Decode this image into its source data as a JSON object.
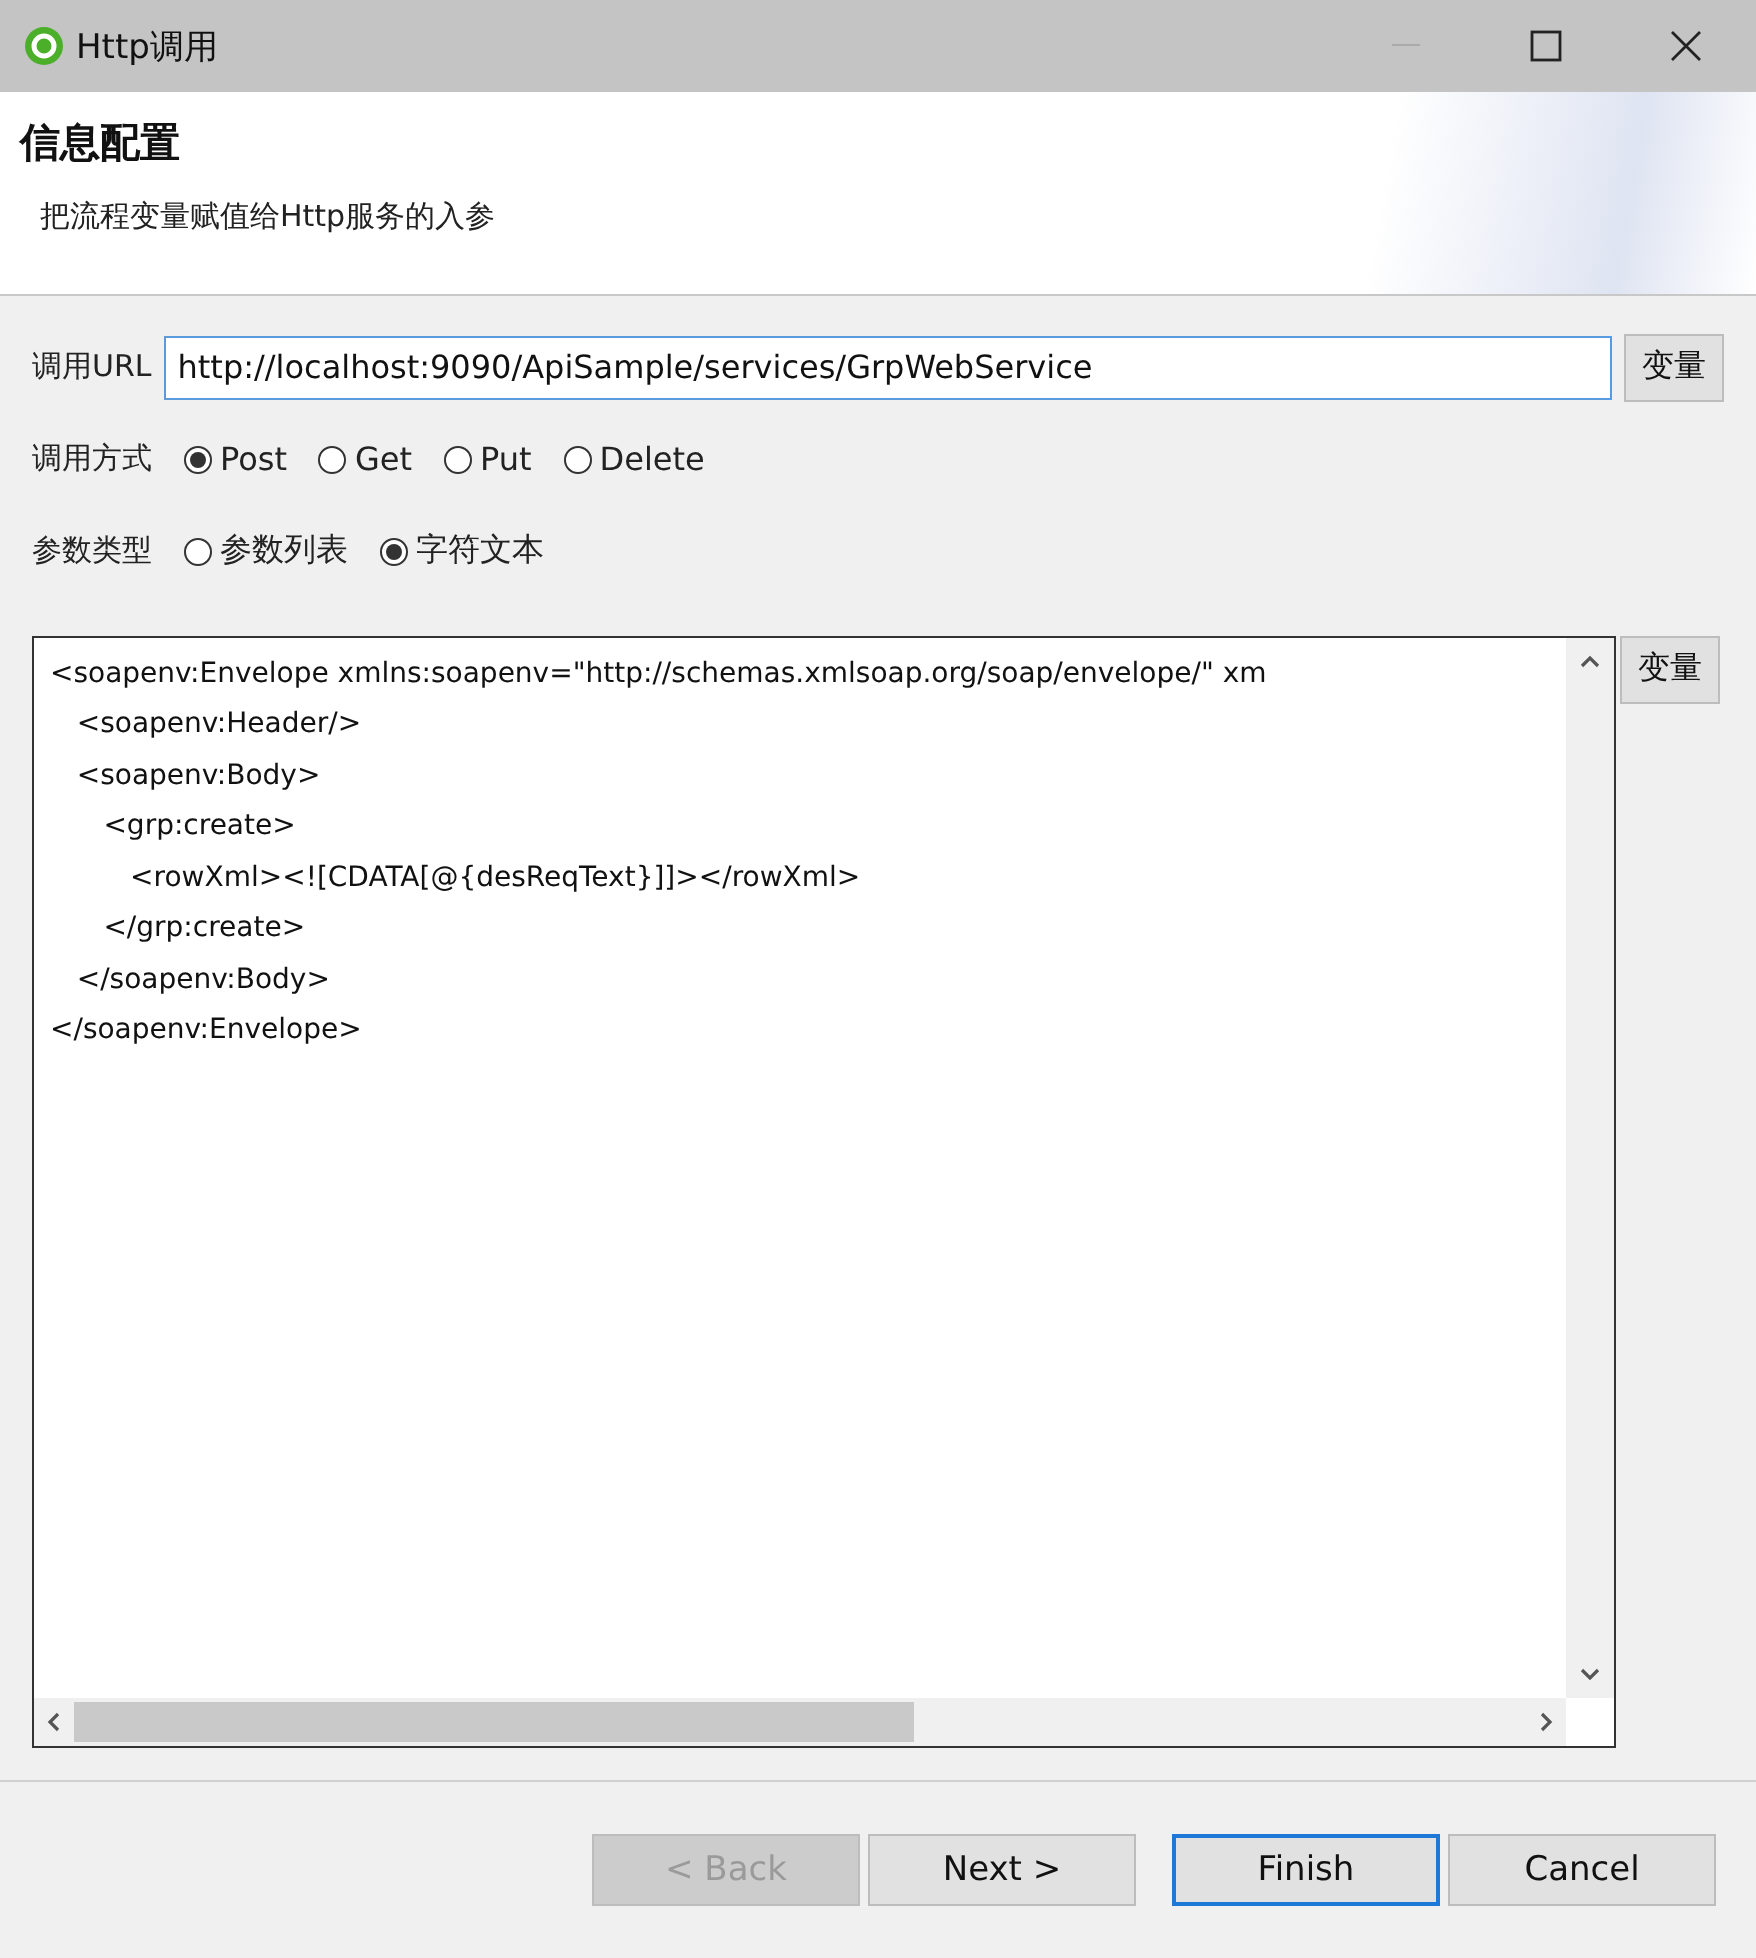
{
  "window": {
    "title": "Http调用"
  },
  "header": {
    "title": "信息配置",
    "description": "把流程变量赋值给Http服务的入参"
  },
  "url": {
    "label": "调用URL",
    "value": "http://localhost:9090/ApiSample/services/GrpWebService",
    "button": "变量"
  },
  "radio_groups": [
    {
      "label": "调用方式",
      "options": [
        {
          "label": "Post",
          "selected": true
        },
        {
          "label": "Get",
          "selected": false
        },
        {
          "label": "Put",
          "selected": false
        },
        {
          "label": "Delete",
          "selected": false
        }
      ]
    },
    {
      "label": "参数类型",
      "options": [
        {
          "label": "参数列表",
          "selected": false
        },
        {
          "label": "字符文本",
          "selected": true
        }
      ]
    }
  ],
  "body": {
    "lines": [
      "<soapenv:Envelope xmlns:soapenv=\"http://schemas.xmlsoap.org/soap/envelope/\" xm",
      "   <soapenv:Header/>",
      "   <soapenv:Body>",
      "      <grp:create>",
      "         <rowXml><![CDATA[@{desReqText}]]></rowXml>",
      "      </grp:create>",
      "   </soapenv:Body>",
      "</soapenv:Envelope>"
    ],
    "button": "变量"
  },
  "buttons": [
    {
      "label": "< Back",
      "disabled": true,
      "default": false
    },
    {
      "label": "Next >",
      "disabled": false,
      "default": false
    },
    {
      "label": "Finish",
      "disabled": false,
      "default": true
    },
    {
      "label": "Cancel",
      "disabled": false,
      "default": false
    }
  ]
}
